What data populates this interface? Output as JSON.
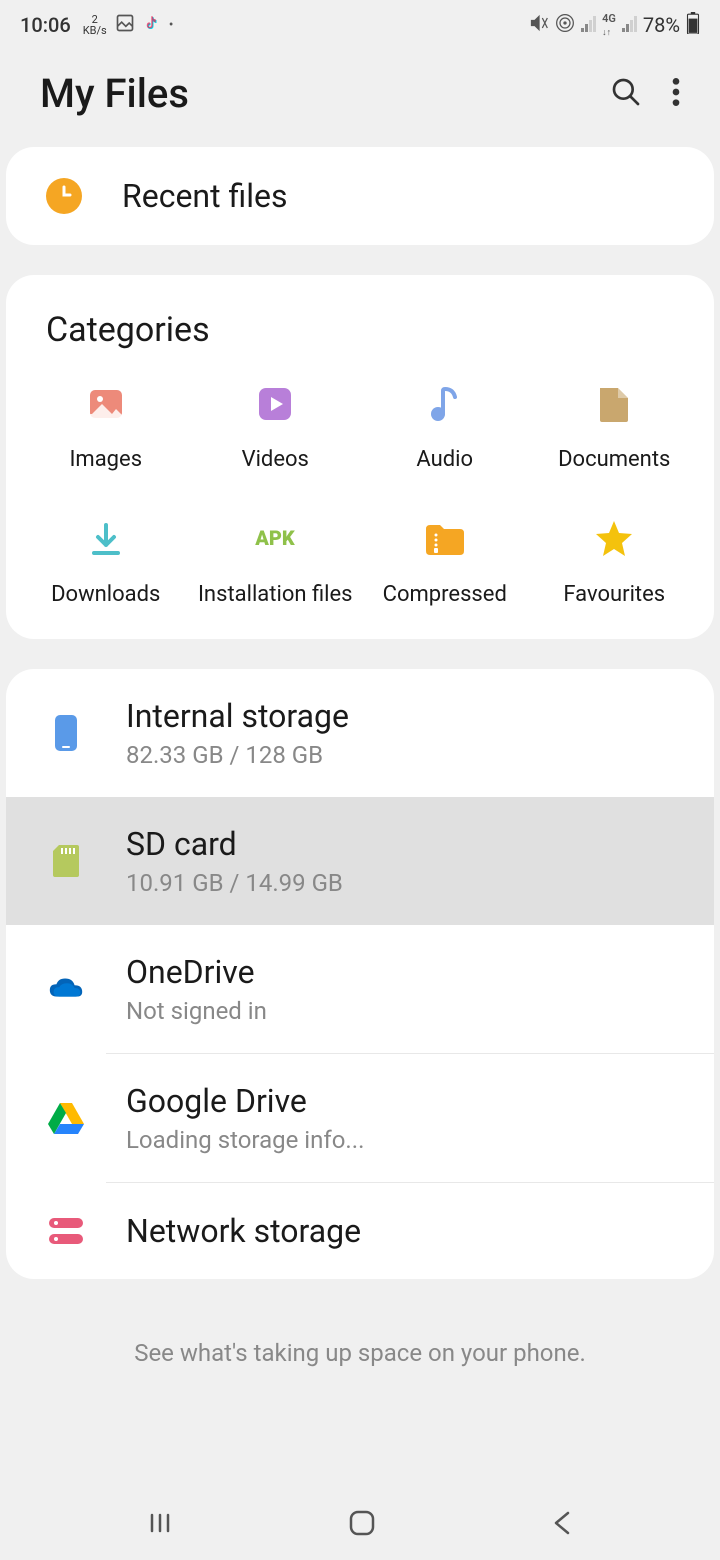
{
  "statusBar": {
    "time": "10:06",
    "speed": "2",
    "speedUnit": "KB/s",
    "battery": "78%"
  },
  "header": {
    "title": "My Files"
  },
  "recent": {
    "title": "Recent files"
  },
  "categories": {
    "title": "Categories",
    "items": [
      {
        "label": "Images"
      },
      {
        "label": "Videos"
      },
      {
        "label": "Audio"
      },
      {
        "label": "Documents"
      },
      {
        "label": "Downloads"
      },
      {
        "label": "Installation files"
      },
      {
        "label": "Compressed"
      },
      {
        "label": "Favourites"
      }
    ]
  },
  "storage": {
    "internal": {
      "title": "Internal storage",
      "subtitle": "82.33 GB / 128 GB"
    },
    "sdcard": {
      "title": "SD card",
      "subtitle": "10.91 GB / 14.99 GB"
    },
    "onedrive": {
      "title": "OneDrive",
      "subtitle": "Not signed in"
    },
    "googledrive": {
      "title": "Google Drive",
      "subtitle": "Loading storage info..."
    },
    "network": {
      "title": "Network storage"
    }
  },
  "tip": "See what's taking up space on your phone."
}
